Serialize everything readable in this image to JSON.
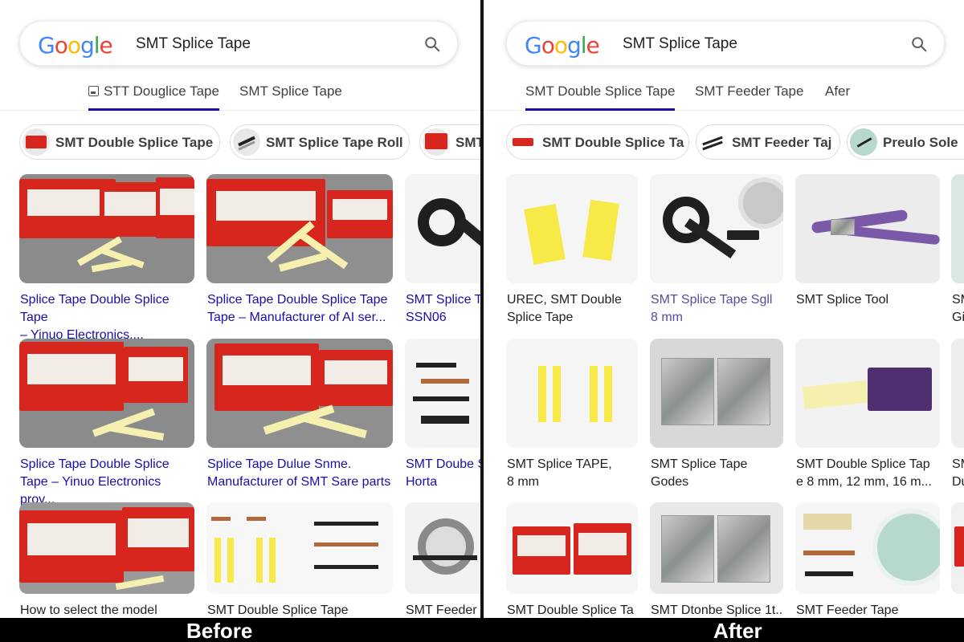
{
  "before": {
    "query": "SMT Splice Tape",
    "tabs": [
      "STT Douglice Tape",
      "SMT Splice Tape"
    ],
    "chips": [
      "SMT Double Splice Tape",
      "SMT Splice Tape Roll",
      "SMT"
    ],
    "results": [
      "Splice Tape Double Splice Tape\n– Yinuo Electronics....",
      "Splice Tape Double Splice Tape\nTape – Manufacturer of AI ser...",
      "SMT Splice Ta\nSSN06",
      "Splice Tape Double Splice\nTape – Yinuo Electronics prov...",
      "Splice Tape Dulue Snme.\nManufacturer of SMT Sare parts",
      "SMT Doube S\nHorta",
      "How to select the model",
      "SMT Double Splice Tape",
      "SMT Feeder T"
    ],
    "image_text": [
      "Doublelal Nane",
      "SMT Dotbin Noad",
      "SMT Dotbisi Hoaobeis",
      "SMT Doltiisi Hocode",
      "SMTDotbisitDonnten"
    ]
  },
  "after": {
    "query": "SMT Splice Tape",
    "tabs": [
      "SMT Double Splice Tape",
      "SMT Feeder Tape",
      "Afer"
    ],
    "chips": [
      "SMT Double Splice Ta",
      "SMT Feeder Taj",
      "Preulo Sole"
    ],
    "results": [
      "UREC, SMT Double\nSplice Tape",
      "SMT Splice Tape Sgll\n8 mm",
      "SMT Splice Tool",
      "SM\nGi",
      "SMT Splice TAPE,\n8 mm",
      "SMT Splice Tape\nGodes",
      "SMT Double Splice Tap\ne 8 mm, 12 mm, 16 m...",
      "SM\nDu",
      "SMT Double Splice Ta",
      "SMT Dtonbe Splice 1t..",
      "SMT Feeder Tape"
    ]
  },
  "labels": {
    "before": "Before",
    "after": "After"
  },
  "colors": {
    "link": "#1a0dab",
    "visited": "#5a4aa0",
    "box_red": "#d7261e",
    "tape_yellow": "#f7e948"
  },
  "icons": [
    "google-logo",
    "search-icon",
    "image-tab-icon"
  ]
}
